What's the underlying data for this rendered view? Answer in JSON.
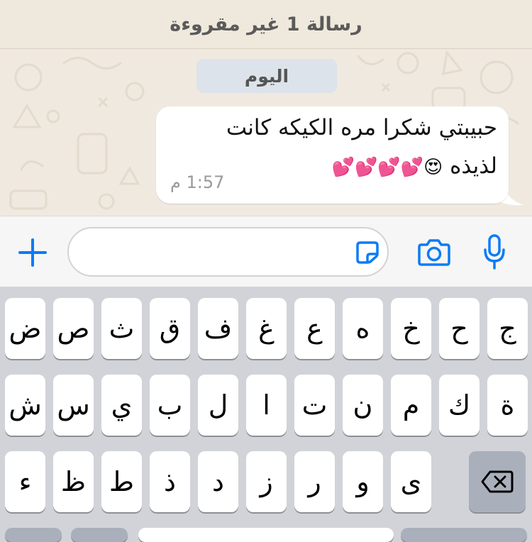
{
  "banner": {
    "unread_text": "رسالة 1 غير مقروءة"
  },
  "chat": {
    "day_label": "اليوم",
    "message": {
      "line1": "حبيبتي شكرا مره الكيكه كانت",
      "line2_text": "لذيذه",
      "line2_emojis": "😍💕💕💕💕",
      "time": "1:57 م"
    }
  },
  "input_bar": {
    "icons": [
      "plus-icon",
      "sticker-icon",
      "camera-icon",
      "microphone-icon"
    ],
    "accent_color": "#0b7cf5"
  },
  "keyboard": {
    "row1": [
      "ض",
      "ص",
      "ث",
      "ق",
      "ف",
      "غ",
      "ع",
      "ه",
      "خ",
      "ح",
      "ج"
    ],
    "row2": [
      "ش",
      "س",
      "ي",
      "ب",
      "ل",
      "ا",
      "ت",
      "ن",
      "م",
      "ك",
      "ة"
    ],
    "row3": [
      "ء",
      "ظ",
      "ط",
      "ذ",
      "د",
      "ز",
      "ر",
      "و",
      "ى"
    ],
    "delete_icon": "backspace-icon"
  }
}
